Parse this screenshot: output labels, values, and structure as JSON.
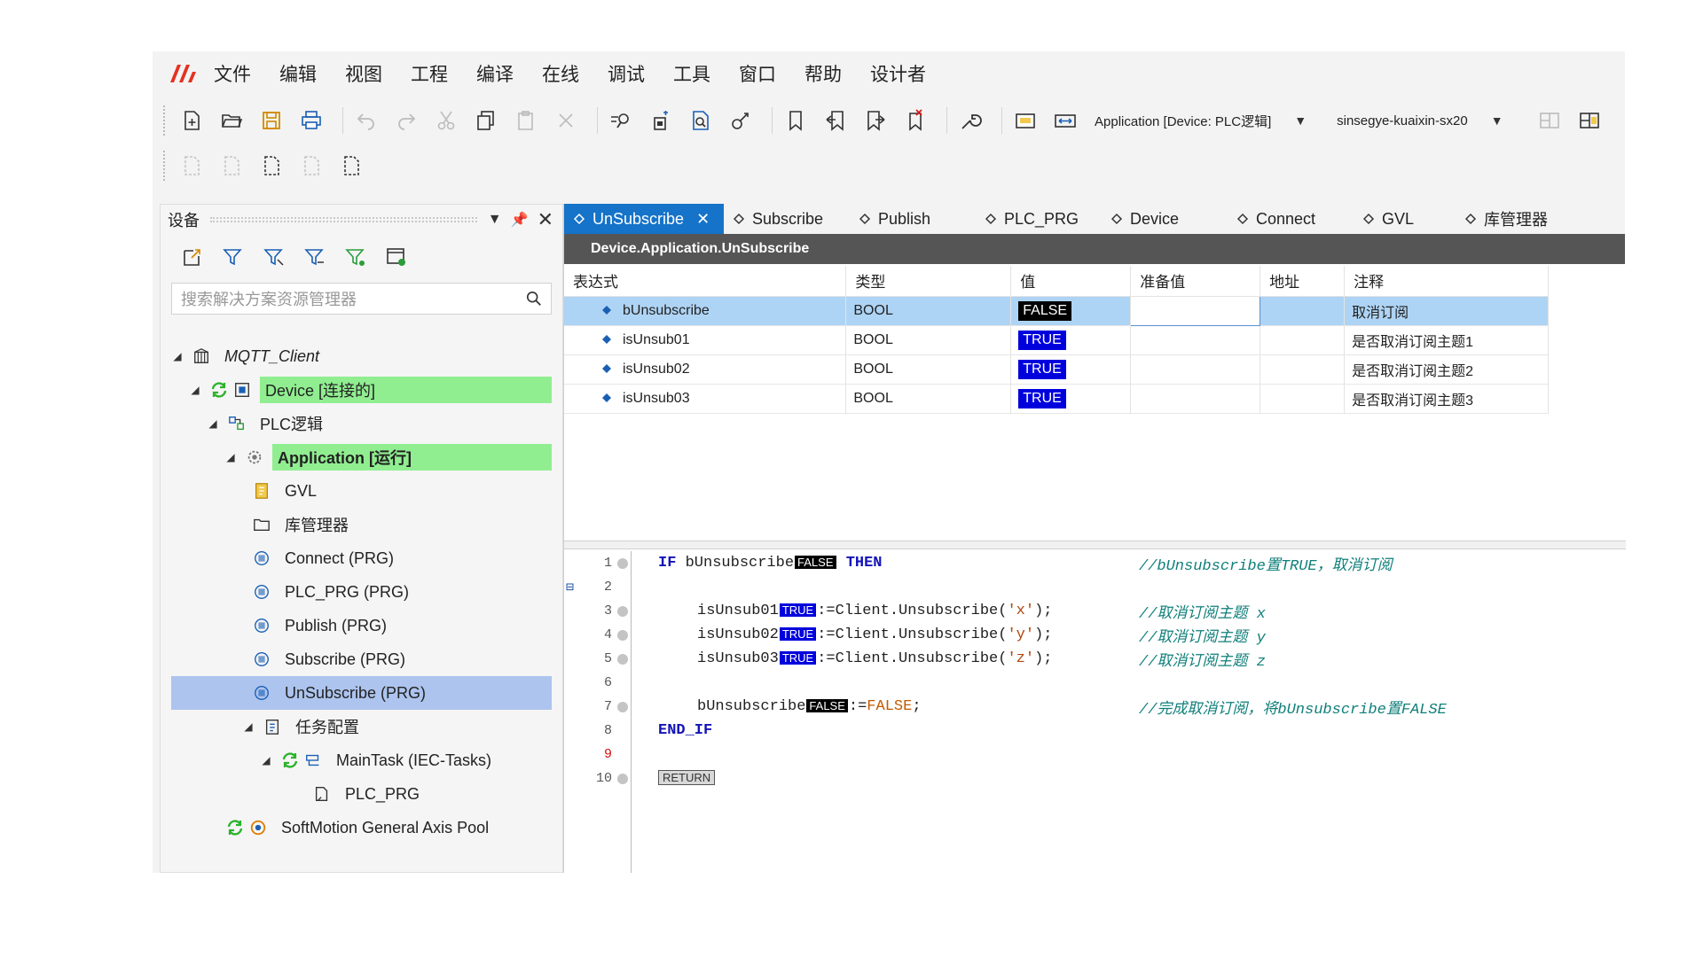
{
  "menu": [
    "文件",
    "编辑",
    "视图",
    "工程",
    "编译",
    "在线",
    "调试",
    "工具",
    "窗口",
    "帮助",
    "设计者"
  ],
  "toolbar": {
    "app_combo": "Application [Device: PLC逻辑]",
    "gateway_combo": "sinsegye-kuaixin-sx20"
  },
  "devices_panel": {
    "title": "设备",
    "search_placeholder": "搜索解决方案资源管理器",
    "tree": [
      {
        "label": "MQTT_Client"
      },
      {
        "label": "Device [连接的]"
      },
      {
        "label": "PLC逻辑"
      },
      {
        "label": "Application [运行]"
      },
      {
        "label": "GVL"
      },
      {
        "label": "库管理器"
      },
      {
        "label": "Connect (PRG)"
      },
      {
        "label": "PLC_PRG (PRG)"
      },
      {
        "label": "Publish (PRG)"
      },
      {
        "label": "Subscribe (PRG)"
      },
      {
        "label": "UnSubscribe (PRG)"
      },
      {
        "label": "任务配置"
      },
      {
        "label": "MainTask (IEC-Tasks)"
      },
      {
        "label": "PLC_PRG"
      },
      {
        "label": "SoftMotion General Axis Pool"
      }
    ]
  },
  "tabs": [
    "UnSubscribe",
    "Subscribe",
    "Publish",
    "PLC_PRG",
    "Device",
    "Connect",
    "GVL",
    "库管理器"
  ],
  "path": "Device.Application.UnSubscribe",
  "watch": {
    "headers": [
      "表达式",
      "类型",
      "值",
      "准备值",
      "地址",
      "注释"
    ],
    "rows": [
      {
        "expr": "bUnsubscribe",
        "type": "BOOL",
        "value": "FALSE",
        "prepared": "",
        "address": "",
        "comment": "取消订阅"
      },
      {
        "expr": "isUnsub01",
        "type": "BOOL",
        "value": "TRUE",
        "prepared": "",
        "address": "",
        "comment": "是否取消订阅主题1"
      },
      {
        "expr": "isUnsub02",
        "type": "BOOL",
        "value": "TRUE",
        "prepared": "",
        "address": "",
        "comment": "是否取消订阅主题2"
      },
      {
        "expr": "isUnsub03",
        "type": "BOOL",
        "value": "TRUE",
        "prepared": "",
        "address": "",
        "comment": "是否取消订阅主题3"
      }
    ]
  },
  "code": {
    "line_numbers": [
      "1",
      "2",
      "3",
      "4",
      "5",
      "6",
      "7",
      "8",
      "9",
      "10"
    ],
    "kw_if": "IF",
    "kw_then": "THEN",
    "kw_end_if": "END_IF",
    "var_b": "bUnsubscribe",
    "var_1": "isUnsub01",
    "var_2": "isUnsub02",
    "var_3": "isUnsub03",
    "val_false": "FALSE",
    "val_true": "TRUE",
    "call_prefix": ":=Client.Unsubscribe(",
    "arg_x": "'x'",
    "arg_y": "'y'",
    "arg_z": "'z'",
    "call_suffix": ");",
    "assign_false_op": ":=",
    "assign_false_val": "FALSE",
    "semicolon": ";",
    "comment_1": "//bUnsubscribe置TRUE，取消订阅",
    "comment_3": "//取消订阅主题 x",
    "comment_4": "//取消订阅主题 y",
    "comment_5": "//取消订阅主题 z",
    "comment_7": "//完成取消订阅，将bUnsubscribe置FALSE",
    "return_label": "RETURN"
  }
}
